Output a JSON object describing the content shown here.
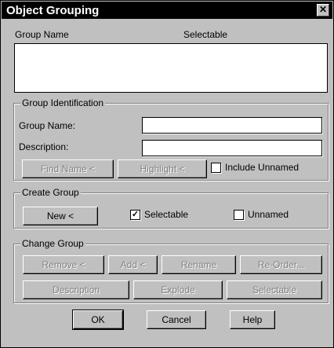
{
  "window": {
    "title": "Object Grouping",
    "close_glyph": "✕"
  },
  "list": {
    "col_group_name": "Group Name",
    "col_selectable": "Selectable"
  },
  "group_identification": {
    "legend": "Group Identification",
    "group_name_label": "Group Name:",
    "group_name_value": "",
    "description_label": "Description:",
    "description_value": "",
    "find_name_button": "Find Name <",
    "highlight_button": "Highlight <",
    "include_unnamed_label": "Include Unnamed",
    "include_unnamed_checked": false
  },
  "create_group": {
    "legend": "Create Group",
    "new_button": "New <",
    "selectable_label": "Selectable",
    "selectable_checked": true,
    "selectable_mark": "✓",
    "unnamed_label": "Unnamed",
    "unnamed_checked": false
  },
  "change_group": {
    "legend": "Change Group",
    "remove_button": "Remove <",
    "add_button": "Add <",
    "rename_button": "Rename",
    "reorder_button": "Re-Order...",
    "description_button": "Description",
    "explode_button": "Explode",
    "selectable_button": "Selectable"
  },
  "footer": {
    "ok_button": "OK",
    "cancel_button": "Cancel",
    "help_button": "Help"
  }
}
